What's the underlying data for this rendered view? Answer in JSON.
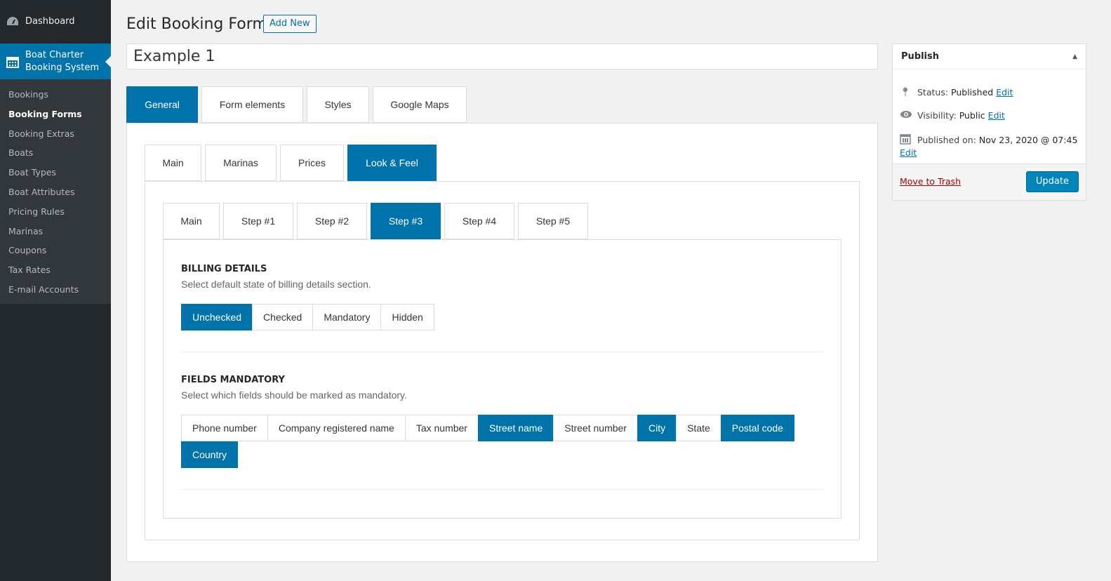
{
  "sidebar": {
    "dashboard": "Dashboard",
    "current": "Boat Charter Booking System",
    "items": [
      "Bookings",
      "Booking Forms",
      "Booking Extras",
      "Boats",
      "Boat Types",
      "Boat Attributes",
      "Pricing Rules",
      "Marinas",
      "Coupons",
      "Tax Rates",
      "E-mail Accounts"
    ],
    "active": "Booking Forms"
  },
  "header": {
    "title": "Edit Booking Form",
    "add_new": "Add New",
    "form_title": "Example 1"
  },
  "tabs": {
    "main": [
      "General",
      "Form elements",
      "Styles",
      "Google Maps"
    ],
    "sub": [
      "Main",
      "Marinas",
      "Prices",
      "Look & Feel"
    ],
    "steps": [
      "Main",
      "Step #1",
      "Step #2",
      "Step #3",
      "Step #4",
      "Step #5"
    ]
  },
  "billing": {
    "heading": "BILLING DETAILS",
    "desc": "Select default state of billing details section.",
    "options": [
      {
        "label": "Unchecked",
        "selected": true
      },
      {
        "label": "Checked",
        "selected": false
      },
      {
        "label": "Mandatory",
        "selected": false
      },
      {
        "label": "Hidden",
        "selected": false
      }
    ]
  },
  "mandatory": {
    "heading": "FIELDS MANDATORY",
    "desc": "Select which fields should be marked as mandatory.",
    "options": [
      {
        "label": "Phone number",
        "selected": false
      },
      {
        "label": "Company registered name",
        "selected": false
      },
      {
        "label": "Tax number",
        "selected": false
      },
      {
        "label": "Street name",
        "selected": true
      },
      {
        "label": "Street number",
        "selected": false
      },
      {
        "label": "City",
        "selected": true
      },
      {
        "label": "State",
        "selected": false
      },
      {
        "label": "Postal code",
        "selected": true
      },
      {
        "label": "Country",
        "selected": true
      }
    ]
  },
  "publish": {
    "title": "Publish",
    "status_label": "Status:",
    "status": "Published",
    "visibility_label": "Visibility:",
    "visibility": "Public",
    "published_label": "Published on:",
    "published": "Nov 23, 2020 @ 07:45",
    "edit": "Edit",
    "trash": "Move to Trash",
    "update": "Update"
  },
  "colors": {
    "accent": "#0073aa",
    "sidebar": "#23282d",
    "trash": "#a00"
  }
}
